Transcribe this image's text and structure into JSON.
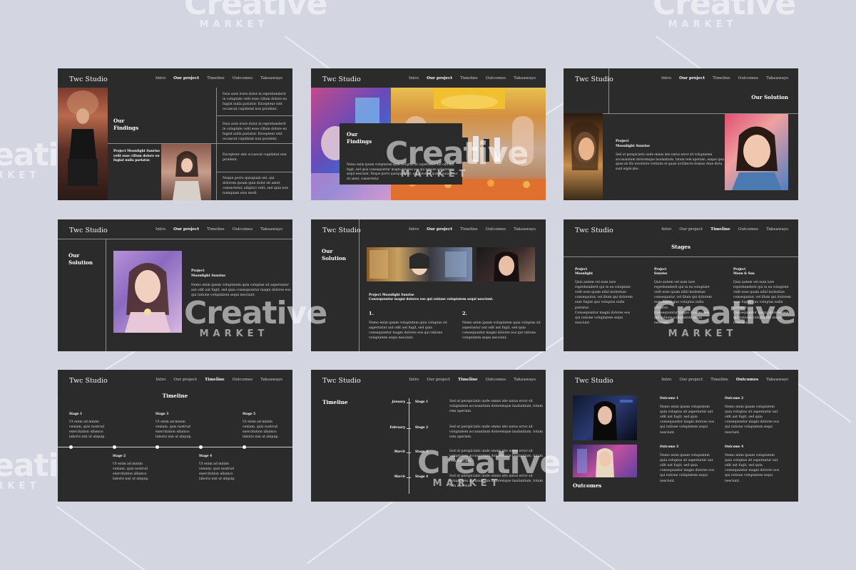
{
  "watermark": {
    "brand": "Creative",
    "sub": "MARKET"
  },
  "common": {
    "logo": "Twc Studio",
    "nav": [
      "Intro",
      "Our project",
      "Timeline",
      "Outcomes",
      "Takeaways"
    ]
  },
  "slide1": {
    "title": "Our\nFindings",
    "project_text": "Project Moonlight Sunrise\nvelit esse cillum dolore eu\nfugiat nulla pariatur.",
    "cells": [
      "Duis aute irure dolor in reprehenderit\nin voluptate velit esse cillum dolore eu\nfugiat nulla pariatur. Excepteur sint\noccaecat cupidatat non proident.",
      "Duis aute irure dolor in reprehenderit\nin voluptate velit esse cillum dolore eu\nfugiat nulla pariatur. Excepteur sint\noccaecat cupidatat non proident.",
      "Excepteur sint occaecat cupidatat non\nproident.",
      "Neque porro quisquam est, qui\ndolorem ipsum quia dolor sit amet,\nconsectetur, adipisci velit, sed quia non\nnumquam eius modi."
    ]
  },
  "slide2": {
    "title": "Our\nFindings",
    "body": "Nemo enim ipsam voluptatem quia voluptas sit aspernatur aut odit aut\nfugit, sed quia consequuntur magni dolores eos qui ratione voluptatem\nsequi nesciunt. Neque porro quisquam est, qui dolorem ipsum quia dolor\nsit amet, consectetur"
  },
  "slide3": {
    "title": "Our Solution",
    "project": "Project\nMoonlight Sunrise",
    "body": "Sed ut perspiciatis unde omnis iste natus error sit voluptatem\naccusantium doloremque laudantium, totam rem aperiam, eaque ipsa\nquae ab illo inventore veritatis et quasi architecto beatae vitae dicta\nsunt explicabo."
  },
  "slide4": {
    "title": "Our\nSolution",
    "project": "Project\nMoonlight Sunrise",
    "body": "Nemo enim ipsam voluptatem quia voluptas sit aspernatur\naut odit aut fugit, sed quia consequuntur magni dolores eos\nqui ratione voluptatem sequi nesciunt."
  },
  "slide5": {
    "title": "Our\nSolution",
    "project": "Project Moonlight Sunrise\nConsequuntur magni dolores eos qui ratione voluptatem sequi nesciunt.",
    "n1": "1.",
    "n2": "2.",
    "b1": "Nemo enim ipsam voluptatem quia voluptas sit\naspernatur aut odit aut fugit, sed quia\nconsequuntur magni dolores eos qui ratione\nvoluptatem sequi nesciunt.",
    "b2": "Nemo enim ipsam voluptatem quia voluptas sit\naspernatur aut odit aut fugit, sed quia\nconsequuntur magni dolores eos qui ratione\nvoluptatem sequi nesciunt."
  },
  "slide6": {
    "title": "Stages",
    "cols": [
      {
        "head": "Project\nMoonlight",
        "body": "Quis autem vel eum iure\nreprehenderit qui in ea voluptate\nvelit esse quam nihil molestiae\nconsequatur, vel illum qui dolorem\neum fugiat quo voluptas nulla\npariatur.",
        "body2": "Consequuntur magni dolores eos\nqui ratione voluptatem sequi\nnesciunt."
      },
      {
        "head": "Project\nSunrise",
        "body": "Quis autem vel eum iure\nreprehenderit qui in ea voluptate\nvelit esse quam nihil molestiae\nconsequatur, vel illum qui dolorem\neum fugiat quo voluptas nulla\npariatur.",
        "body2": "Consequuntur magni dolores eos\nqui ratione voluptatem sequi\nnesciunt."
      },
      {
        "head": "Project\nMoon & Sun",
        "body": "Quis autem vel eum iure\nreprehenderit qui in ea voluptate\nvelit esse quam nihil molestiae\nconsequatur, vel illum qui dolorem\neum fugiat quo voluptas nulla\npariatur.",
        "body2": "Consequuntur magni dolores eos\nqui ratione voluptatem sequi\nnesciunt."
      }
    ]
  },
  "slide7": {
    "title": "Timeline",
    "top_stages": [
      {
        "label": "Stage 1",
        "body": "Ut enim ad minim\nveniam, quis nostrud\nexercitation ullamco\nlaboris nisi ut aliquip."
      },
      {
        "label": "Stage 3",
        "body": "Ut enim ad minim\nveniam, quis nostrud\nexercitation ullamco\nlaboris nisi ut aliquip."
      },
      {
        "label": "Stage 5",
        "body": "Ut enim ad minim\nveniam, quis nostrud\nexercitation ullamco\nlaboris nisi ut aliquip."
      }
    ],
    "bottom_stages": [
      {
        "label": "Stage 2",
        "body": "Ut enim ad minim\nveniam, quis nostrud\nexercitation ullamco\nlaboris nisi ut aliquip."
      },
      {
        "label": "Stage 4",
        "body": "Ut enim ad minim\nveniam, quis nostrud\nexercitation ullamco\nlaboris nisi ut aliquip."
      }
    ]
  },
  "slide8": {
    "title": "Timeline",
    "rows": [
      {
        "month": "January",
        "stage": "Stage 1",
        "body": "Sed ut perspiciatis unde omnis iste natus error sit\nvoluptatem accusantium doloremque laudantium, totam\nrem aperiam."
      },
      {
        "month": "February",
        "stage": "Stage 2",
        "body": "Sed ut perspiciatis unde omnis iste natus error sit\nvoluptatem accusantium doloremque laudantium, totam\nrem aperiam."
      },
      {
        "month": "March",
        "stage": "Stage 3",
        "body": "Sed ut perspiciatis unde omnis iste natus error sit\nvoluptatem accusantium doloremque laudantium, totam\nrem aperiam."
      },
      {
        "month": "March",
        "stage": "Stage 4",
        "body": "Sed ut perspiciatis unde omnis iste natus error sit\nvoluptatem accusantium doloremque laudantium, totam\nrem aperiam."
      }
    ]
  },
  "slide9": {
    "title": "Outcomes",
    "items": [
      {
        "label": "Outcome 1",
        "body": "Nemo enim ipsam voluptatem\nquia voluptas sit aspernatur aut\nodit aut fugit, sed quia\nconsequuntur magni dolores eos\nqui ratione voluptatem sequi\nnesciunt."
      },
      {
        "label": "Outcome 2",
        "body": "Nemo enim ipsam voluptatem\nquia voluptas sit aspernatur aut\nodit aut fugit, sed quia\nconsequuntur magni dolores eos\nqui ratione voluptatem sequi\nnesciunt."
      },
      {
        "label": "Outcome 3",
        "body": "Nemo enim ipsam voluptatem\nquia voluptas sit aspernatur aut\nodit aut fugit, sed quia\nconsequuntur magni dolores eos\nqui ratione voluptatem sequi\nnesciunt."
      },
      {
        "label": "Outcome 4",
        "body": "Nemo enim ipsam voluptatem\nquia voluptas sit aspernatur aut\nodit aut fugit, sed quia\nconsequuntur magni dolores eos\nqui ratione voluptatem sequi\nnesciunt."
      }
    ]
  }
}
